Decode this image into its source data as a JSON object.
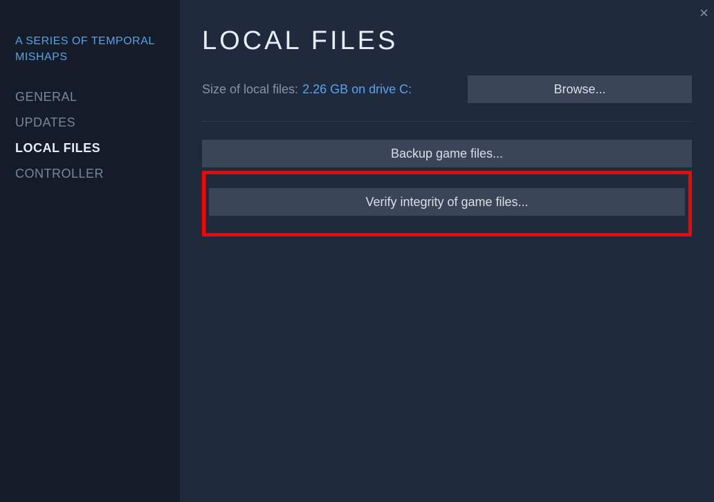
{
  "sidebar": {
    "game_title": "A SERIES OF TEMPORAL MISHAPS",
    "items": [
      {
        "label": "GENERAL",
        "active": false
      },
      {
        "label": "UPDATES",
        "active": false
      },
      {
        "label": "LOCAL FILES",
        "active": true
      },
      {
        "label": "CONTROLLER",
        "active": false
      }
    ]
  },
  "main": {
    "title": "LOCAL FILES",
    "size_label": "Size of local files:",
    "size_value": "2.26 GB on drive C:",
    "browse_label": "Browse...",
    "backup_label": "Backup game files...",
    "verify_label": "Verify integrity of game files..."
  },
  "close_symbol": "×"
}
